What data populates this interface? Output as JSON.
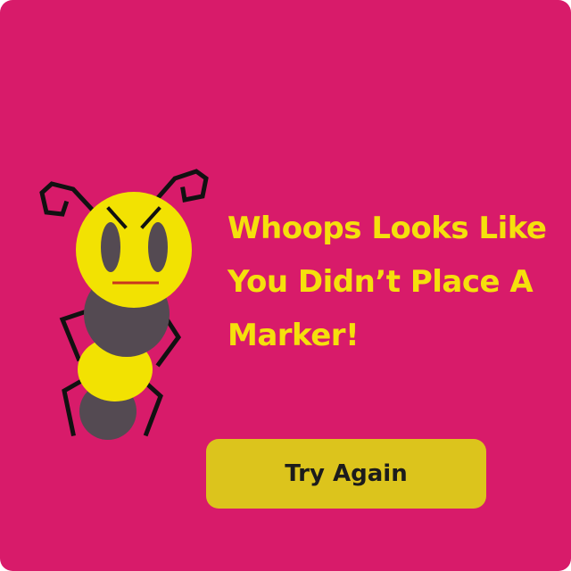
{
  "dialog": {
    "message": "Whoops Looks Like You Didn’t Place A Marker!",
    "button_label": "Try Again"
  },
  "colors": {
    "background": "#d81b6a",
    "message_text": "#f5e00c",
    "button_bg": "#dcc41c",
    "button_text": "#1c1c1c",
    "bee_yellow": "#f2e202",
    "bee_dark": "#544a52",
    "bee_mouth": "#c8361e"
  },
  "icons": {
    "mascot": "angry-bee-icon"
  }
}
